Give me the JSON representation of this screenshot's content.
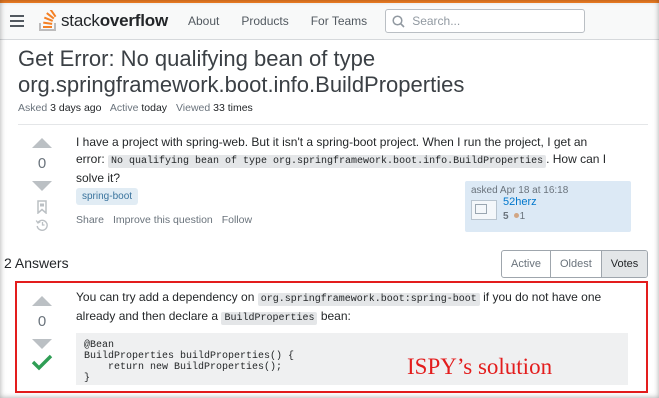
{
  "header": {
    "logo_text_light": "stack",
    "logo_text_bold": "overflow",
    "nav": [
      "About",
      "Products",
      "For Teams"
    ],
    "search_placeholder": "Search..."
  },
  "question": {
    "title": "Get Error: No qualifying bean of type org.springframework.boot.info.BuildProperties",
    "meta": {
      "asked_label": "Asked",
      "asked_value": "3 days ago",
      "active_label": "Active",
      "active_value": "today",
      "viewed_label": "Viewed",
      "viewed_value": "33 times"
    },
    "votes": "0",
    "body": {
      "line1": "I have a project with spring-web. But it isn't a spring-boot project. When I run the project, I get an",
      "error_label": "error:",
      "error_code": "No qualifying bean of type org.springframework.boot.info.BuildProperties",
      "after_code": ". How can I",
      "line3": "solve it?"
    },
    "tags": [
      "spring-boot"
    ],
    "menu": [
      "Share",
      "Improve this question",
      "Follow"
    ],
    "user_card": {
      "asked": "asked Apr 18 at 16:18",
      "name": "52herz",
      "reputation": "5",
      "bronze": "1"
    }
  },
  "answers": {
    "count_label": "2 Answers",
    "sort_tabs": [
      "Active",
      "Oldest",
      "Votes"
    ],
    "active_tab": "Votes",
    "first": {
      "votes": "0",
      "text_before": "You can try add a dependency on",
      "dep_code": "org.springframework.boot:spring-boot",
      "text_after": "if you do not have one",
      "line2_before": "already and then declare a",
      "bean_code": "BuildProperties",
      "line2_after": "bean:",
      "code": "@Bean\nBuildProperties buildProperties() {\n    return new BuildProperties();\n}"
    }
  },
  "annotation": "ISPY’s solution",
  "colors": {
    "accent_orange": "#f48024",
    "highlight_red": "#e31d1d",
    "accepted_green": "#2f9e55",
    "link_blue": "#0077cc"
  }
}
